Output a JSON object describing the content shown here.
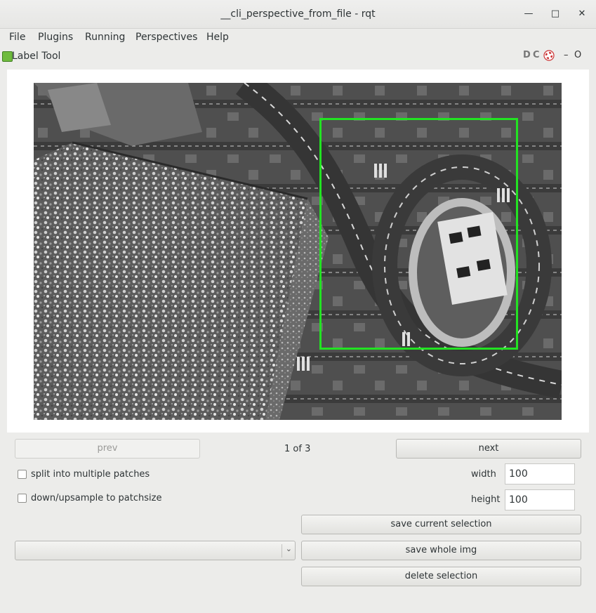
{
  "window": {
    "title": "__cli_perspective_from_file - rqt",
    "minimize_glyph": "—",
    "maximize_glyph": "□",
    "close_glyph": "✕"
  },
  "menu": {
    "items": [
      "File",
      "Plugins",
      "Running",
      "Perspectives",
      "Help"
    ]
  },
  "dock": {
    "title": "Label Tool",
    "icon": "label-tool-icon",
    "right_icons": [
      "D",
      "C",
      "help-icon"
    ],
    "minimize_glyph": "–",
    "close_glyph": "O"
  },
  "image": {
    "description_icon": "camera-image",
    "selection_color": "#22e322"
  },
  "nav": {
    "prev_label": "prev",
    "counter": "1 of 3",
    "next_label": "next"
  },
  "options": {
    "split_label": "split into  multiple patches",
    "resample_label": "down/upsample to patchsize",
    "width_label": "width",
    "width_value": "100",
    "height_label": "height",
    "height_value": "100"
  },
  "actions": {
    "save_selection_label": "save current selection",
    "save_whole_label": "save whole img",
    "delete_label": "delete selection",
    "combo_value": ""
  }
}
